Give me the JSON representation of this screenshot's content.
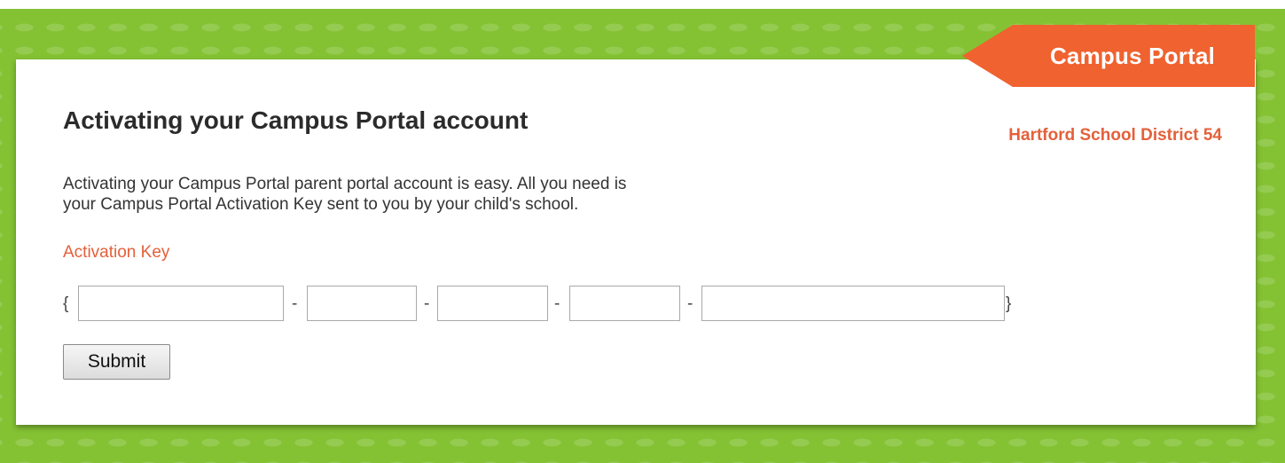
{
  "brand": {
    "ribbon_label": "Campus Portal",
    "district_name": "Hartford School District 54"
  },
  "main": {
    "title": "Activating your Campus Portal account",
    "description_lines": [
      "Activating your Campus Portal parent portal account is easy. All you need is",
      "your Campus Portal Activation Key sent to you by your child's school."
    ],
    "activation_key_label": "Activation Key",
    "key_open_brace": "{",
    "key_close_brace": "}",
    "key_separator": "-",
    "key_segments": [
      {
        "value": ""
      },
      {
        "value": ""
      },
      {
        "value": ""
      },
      {
        "value": ""
      },
      {
        "value": ""
      }
    ],
    "submit_label": "Submit"
  },
  "colors": {
    "background_green": "#84c234",
    "accent_orange": "#f0622f",
    "label_orange": "#e4603a",
    "text_dark": "#2b2b2b"
  }
}
